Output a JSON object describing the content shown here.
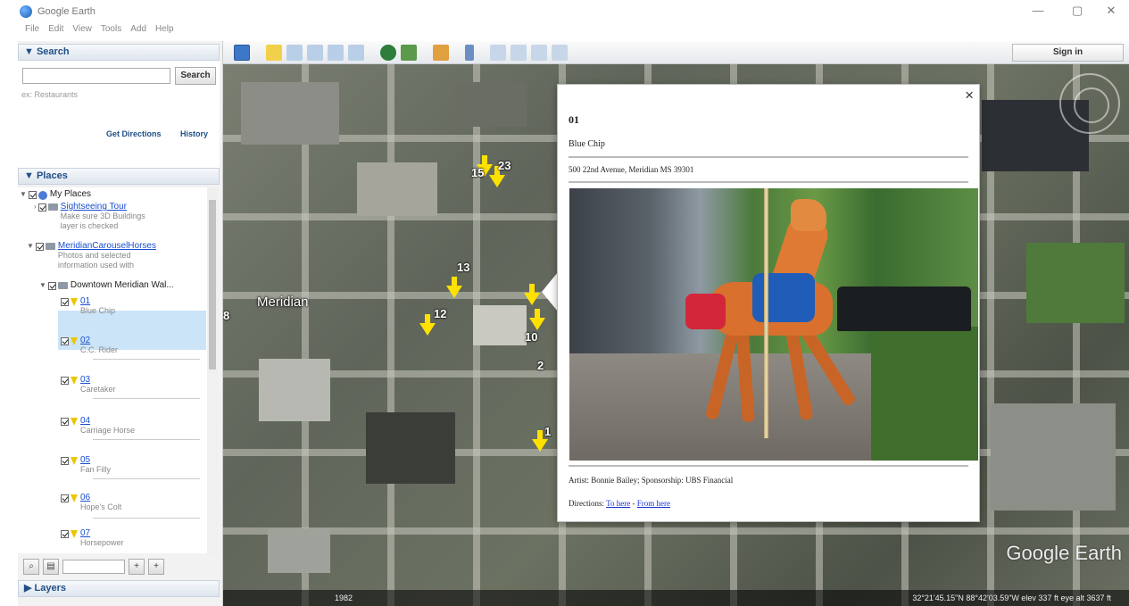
{
  "window": {
    "title": "Google Earth",
    "minimize": "—",
    "maximize": "▢",
    "close": "✕"
  },
  "menu": [
    "File",
    "Edit",
    "View",
    "Tools",
    "Add",
    "Help"
  ],
  "search": {
    "header": "▼ Search",
    "button": "Search",
    "hint": "ex: Restaurants",
    "get_directions": "Get Directions",
    "history": "History"
  },
  "places": {
    "header": "▼ Places",
    "my_places": "My Places",
    "tour_title": "Sightseeing Tour",
    "tour_sub": [
      "Make sure 3D Buildings",
      "layer is checked"
    ],
    "carousel_title": "MeridianCarouselHorses",
    "carousel_sub": [
      "Photos and selected",
      "information used with"
    ],
    "downtown": "Downtown Meridian Wal...",
    "items": [
      {
        "id": "01",
        "name": "Blue Chip"
      },
      {
        "id": "02",
        "name": "C.C. Rider"
      },
      {
        "id": "03",
        "name": "Caretaker"
      },
      {
        "id": "04",
        "name": "Carriage Horse"
      },
      {
        "id": "05",
        "name": "Fan Filly"
      },
      {
        "id": "06",
        "name": "Hope's Colt"
      },
      {
        "id": "07",
        "name": "Horsepower"
      }
    ]
  },
  "layers": {
    "header": "▶ Layers"
  },
  "bottom_tools": {
    "add": "+",
    "remove": "+"
  },
  "toolbar": {
    "sign_in": "Sign in"
  },
  "map": {
    "city_label": "Meridian",
    "logo": "Google Earth",
    "markers": [
      "15",
      "23",
      "13",
      "12",
      "10",
      "8",
      "2",
      "1"
    ],
    "status_left": "1982",
    "status_right": "32°21'45.15\"N  88°42'03.59\"W  elev  337 ft     eye alt  3637 ft"
  },
  "balloon": {
    "close": "×",
    "title": "01",
    "name": "Blue Chip",
    "address": "500 22nd Avenue, Meridian MS 39301",
    "artist": "Artist: Bonnie Bailey; Sponsorship: UBS Financial",
    "directions_label": "Directions:",
    "to_here": "To here",
    "separator": "-",
    "from_here": "From here"
  },
  "colors": {
    "panel_header": "#1f4f86",
    "link": "#1a4fd0",
    "marker": "#ffe100",
    "selection": "#cce4f7"
  }
}
